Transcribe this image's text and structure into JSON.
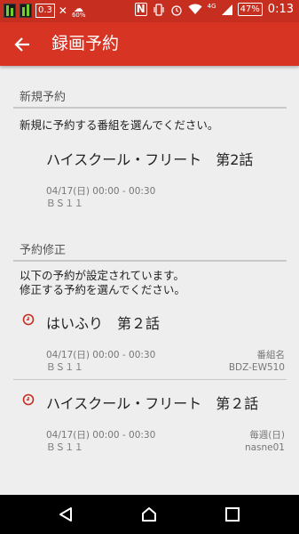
{
  "status_bar": {
    "left_box_label": "0.3",
    "weather_percent": "60%",
    "nfc_label": "N",
    "network_label": "4G",
    "battery": "47%",
    "time": "0:13"
  },
  "app_bar": {
    "title": "録画予約"
  },
  "new_section": {
    "header": "新規予約",
    "info": "新規に予約する番組を選んでください。",
    "item": {
      "title": "ハイスクール・フリート　第2話",
      "datetime": "04/17(日) 00:00 - 00:30",
      "channel": "ＢＳ１１"
    }
  },
  "edit_section": {
    "header": "予約修正",
    "info_line1": "以下の予約が設定されています。",
    "info_line2": "修正する予約を選んでください。",
    "items": [
      {
        "title": "はいふり　第２話",
        "datetime": "04/17(日) 00:00 - 00:30",
        "channel": "ＢＳ１１",
        "tag": "番組名",
        "device": "BDZ-EW510"
      },
      {
        "title": "ハイスクール・フリート　第２話",
        "datetime": "04/17(日) 00:00 - 00:30",
        "channel": "ＢＳ１１",
        "tag": "毎週(日)",
        "device": "nasne01"
      }
    ]
  },
  "colors": {
    "status_bar": "#c62e20",
    "app_bar": "#d83424",
    "alarm": "#c62e20"
  }
}
